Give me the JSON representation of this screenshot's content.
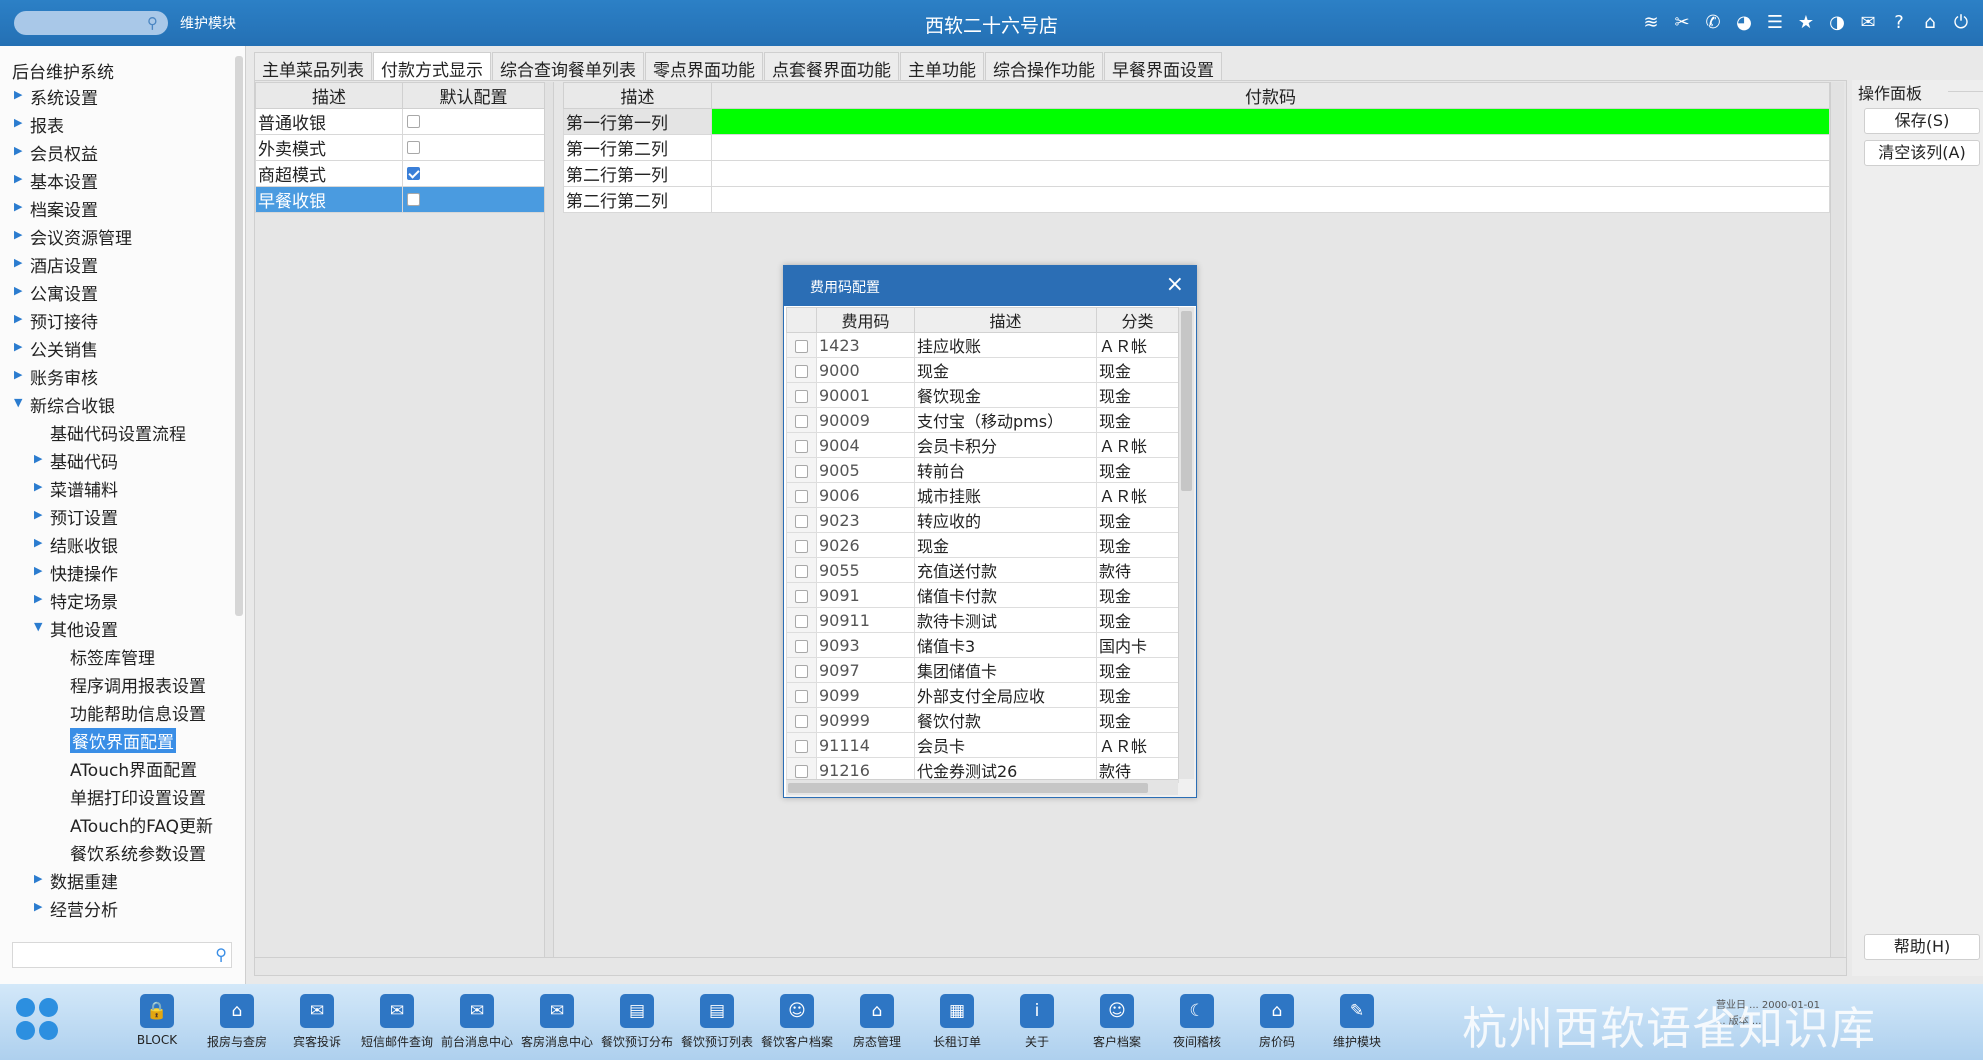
{
  "topbar": {
    "module_label": "维护模块",
    "store_title": "西软二十六号店"
  },
  "sidebar": {
    "root": "后台维护系统",
    "items": [
      {
        "label": "系统设置"
      },
      {
        "label": "报表"
      },
      {
        "label": "会员权益"
      },
      {
        "label": "基本设置"
      },
      {
        "label": "档案设置"
      },
      {
        "label": "会议资源管理"
      },
      {
        "label": "酒店设置"
      },
      {
        "label": "公寓设置"
      },
      {
        "label": "预订接待"
      },
      {
        "label": "公关销售"
      },
      {
        "label": "账务审核"
      },
      {
        "label": "新综合收银"
      },
      {
        "label": "基础代码设置流程"
      },
      {
        "label": "基础代码"
      },
      {
        "label": "菜谱辅料"
      },
      {
        "label": "预订设置"
      },
      {
        "label": "结账收银"
      },
      {
        "label": "快捷操作"
      },
      {
        "label": "特定场景"
      },
      {
        "label": "其他设置"
      },
      {
        "label": "标签库管理"
      },
      {
        "label": "程序调用报表设置"
      },
      {
        "label": "功能帮助信息设置"
      },
      {
        "label": "餐饮界面配置"
      },
      {
        "label": "ATouch界面配置"
      },
      {
        "label": "单据打印设置设置"
      },
      {
        "label": "ATouch的FAQ更新"
      },
      {
        "label": "餐饮系统参数设置"
      },
      {
        "label": "数据重建"
      },
      {
        "label": "经营分析"
      }
    ],
    "search_value": ""
  },
  "tabs": [
    {
      "label": "主单菜品列表"
    },
    {
      "label": "付款方式显示"
    },
    {
      "label": "综合查询餐单列表"
    },
    {
      "label": "零点界面功能"
    },
    {
      "label": "点套餐界面功能"
    },
    {
      "label": "主单功能"
    },
    {
      "label": "综合操作功能"
    },
    {
      "label": "早餐界面设置"
    }
  ],
  "mode_table": {
    "headers": [
      "描述",
      "默认配置"
    ],
    "rows": [
      {
        "desc": "普通收银",
        "checked": false
      },
      {
        "desc": "外卖模式",
        "checked": false
      },
      {
        "desc": "商超模式",
        "checked": true
      },
      {
        "desc": "早餐收银",
        "checked": false
      }
    ]
  },
  "pay_table": {
    "headers": [
      "描述",
      "付款码"
    ],
    "rows": [
      {
        "desc": "第一行第一列",
        "code": ""
      },
      {
        "desc": "第一行第二列",
        "code": ""
      },
      {
        "desc": "第二行第一列",
        "code": ""
      },
      {
        "desc": "第二行第二列",
        "code": ""
      }
    ]
  },
  "ops": {
    "title": "操作面板",
    "save": "保存(S)",
    "clear": "清空该列(A)",
    "help": "帮助(H)"
  },
  "dialog": {
    "title": "费用码配置",
    "headers": [
      "费用码",
      "描述",
      "分类"
    ],
    "rows": [
      {
        "code": "1423",
        "desc": "挂应收账",
        "cat": "ＡＲ帐"
      },
      {
        "code": "9000",
        "desc": "现金",
        "cat": "现金"
      },
      {
        "code": "90001",
        "desc": "餐饮现金",
        "cat": "现金"
      },
      {
        "code": "90009",
        "desc": "支付宝（移动pms）",
        "cat": "现金"
      },
      {
        "code": "9004",
        "desc": "会员卡积分",
        "cat": "ＡＲ帐"
      },
      {
        "code": "9005",
        "desc": "转前台",
        "cat": "现金"
      },
      {
        "code": "9006",
        "desc": "城市挂账",
        "cat": "ＡＲ帐"
      },
      {
        "code": "9023",
        "desc": "转应收的",
        "cat": "现金"
      },
      {
        "code": "9026",
        "desc": "现金",
        "cat": "现金"
      },
      {
        "code": "9055",
        "desc": "充值送付款",
        "cat": "款待"
      },
      {
        "code": "9091",
        "desc": "储值卡付款",
        "cat": "现金"
      },
      {
        "code": "90911",
        "desc": "款待卡测试",
        "cat": "现金"
      },
      {
        "code": "9093",
        "desc": "储值卡3",
        "cat": "国内卡"
      },
      {
        "code": "9097",
        "desc": "集团储值卡",
        "cat": "现金"
      },
      {
        "code": "9099",
        "desc": "外部支付全局应收",
        "cat": "现金"
      },
      {
        "code": "90999",
        "desc": "餐饮付款",
        "cat": "现金"
      },
      {
        "code": "91114",
        "desc": "会员卡",
        "cat": "ＡＲ帐"
      },
      {
        "code": "91216",
        "desc": "代金券测试26",
        "cat": "款待"
      }
    ]
  },
  "taskbar": {
    "apps": [
      {
        "label": "BLOCK"
      },
      {
        "label": "报房与查房"
      },
      {
        "label": "宾客投诉"
      },
      {
        "label": "短信邮件查询"
      },
      {
        "label": "前台消息中心"
      },
      {
        "label": "客房消息中心"
      },
      {
        "label": "餐饮预订分布"
      },
      {
        "label": "餐饮预订列表"
      },
      {
        "label": "餐饮客户档案"
      },
      {
        "label": "房态管理"
      },
      {
        "label": "长租订单"
      },
      {
        "label": "关于"
      },
      {
        "label": "客户档案"
      },
      {
        "label": "夜间稽核"
      },
      {
        "label": "房价码"
      },
      {
        "label": "维护模块"
      }
    ],
    "watermark": "杭州西软语雀知识库"
  },
  "colors": {
    "topbar": "#2a7bc1",
    "selection": "#3a8ee6",
    "green_cell": "#00ff00",
    "dialog_header": "#2b6eb5"
  }
}
